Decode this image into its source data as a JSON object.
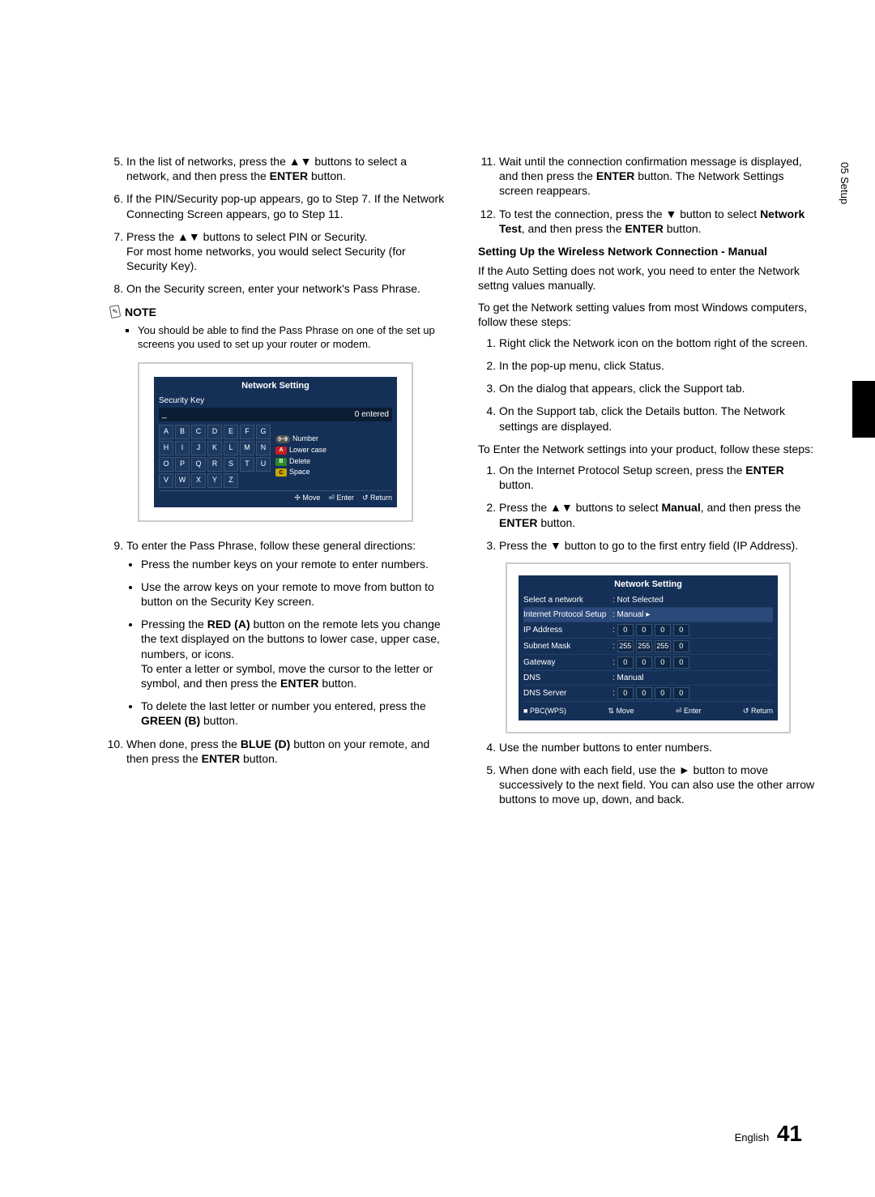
{
  "sideTab": "05 Setup",
  "left": {
    "step5": {
      "pre": "In the list of networks, press the ",
      "arrows": "▲▼",
      "mid": " buttons to select a network, and then press the ",
      "enter": "ENTER",
      "post": " button."
    },
    "step6": "If the PIN/Security pop-up appears, go to Step 7. If the Network Connecting Screen appears, go to Step 11.",
    "step7": {
      "pre": "Press the ",
      "arrows": "▲▼",
      "post1": " buttons to select PIN or Security.",
      "extra": "For most home networks, you would select Security (for Security Key)."
    },
    "step8": "On the Security screen, enter your network's Pass Phrase.",
    "noteLabel": "NOTE",
    "noteItem": "You should be able to find the Pass Phrase on one of the set up screens you used to set up your router or modem.",
    "fig1": {
      "title": "Network Setting",
      "sub": "Security Key",
      "entered": "0 entered",
      "rows": [
        [
          "A",
          "B",
          "C",
          "D",
          "E",
          "F",
          "G"
        ],
        [
          "H",
          "I",
          "J",
          "K",
          "L",
          "M",
          "N"
        ],
        [
          "O",
          "P",
          "Q",
          "R",
          "S",
          "T",
          "U"
        ],
        [
          "V",
          "W",
          "X",
          "Y",
          "Z"
        ]
      ],
      "legend": {
        "number": "Number",
        "lower": "Lower case",
        "delete": "Delete",
        "space": "Space"
      },
      "footer": {
        "move": "Move",
        "enter": "Enter",
        "return": "Return"
      }
    },
    "step9Intro": "To enter the Pass Phrase, follow these general directions:",
    "bullets": {
      "b1": "Press the number keys on your remote to enter numbers.",
      "b2": "Use the arrow keys on your remote to move from button to button on the Security Key screen.",
      "b3a": "Pressing the ",
      "b3red": "RED (A)",
      "b3b": " button on the remote lets you change the text displayed on the buttons to lower case, upper case, numbers, or icons.",
      "b3c": "To enter a letter or symbol, move the cursor to the letter or symbol, and then press the ",
      "b3enter": "ENTER",
      "b3d": " button.",
      "b4a": "To delete the last letter or number you entered, press the ",
      "b4green": "GREEN (B)",
      "b4b": " button."
    },
    "step10": {
      "pre": "When done, press the ",
      "blue": "BLUE (D)",
      "mid": " button on your remote, and then press the ",
      "enter": "ENTER",
      "post": " button."
    }
  },
  "right": {
    "step11": {
      "pre": "Wait until the connection confirmation message is displayed, and then press the ",
      "enter": "ENTER",
      "post": " button. The Network Settings screen reappears."
    },
    "step12": {
      "pre": "To test the connection, press the ",
      "arrow": "▼",
      "mid": " button to select ",
      "nt": "Network Test",
      "mid2": ", and then press the ",
      "enter": "ENTER",
      "post": " button."
    },
    "subheadA": "Setting Up the Wireless Network Connection - Manual",
    "paraA": "If the Auto Setting does not work, you need to enter the Network settng values manually.",
    "paraB": "To get the Network setting values from most Windows computers, follow these steps:",
    "listA": {
      "i1": "Right click the Network icon on the bottom right of the screen.",
      "i2": "In the pop-up menu, click Status.",
      "i3": "On the dialog that appears, click the Support tab.",
      "i4": "On the Support tab, click the Details button. The Network settings are displayed."
    },
    "paraC": "To Enter the Network settings into your product, follow these steps:",
    "listB": {
      "i1a": "On the Internet Protocol Setup screen, press the ",
      "i1enter": "ENTER",
      "i1b": " button.",
      "i2a": "Press the ",
      "i2arrows": "▲▼",
      "i2b": " buttons to select ",
      "i2manual": "Manual",
      "i2c": ", and then press the ",
      "i2enter": "ENTER",
      "i2d": " button.",
      "i3a": "Press the ",
      "i3arrow": "▼",
      "i3b": " button to go to the first entry field (IP Address)."
    },
    "fig2": {
      "title": "Network Setting",
      "rows": {
        "selectLabel": "Select a network",
        "selectVal": ": Not Selected",
        "ipsLabel": "Internet Protocol Setup",
        "ipsVal": ": Manual",
        "ipLabel": "IP Address",
        "ipVals": [
          "0",
          "0",
          "0",
          "0"
        ],
        "snLabel": "Subnet Mask",
        "snVals": [
          "255",
          "255",
          "255",
          "0"
        ],
        "gwLabel": "Gateway",
        "gwVals": [
          "0",
          "0",
          "0",
          "0"
        ],
        "dnsLabel": "DNS",
        "dnsVal": ": Manual",
        "dnssLabel": "DNS Server",
        "dnssVals": [
          "0",
          "0",
          "0",
          "0"
        ]
      },
      "footer": {
        "pbc": "PBC(WPS)",
        "move": "Move",
        "enter": "Enter",
        "return": "Return"
      }
    },
    "listC": {
      "i4": "Use the number buttons to enter numbers.",
      "i5a": "When done with each field, use the ",
      "i5arrow": "►",
      "i5b": " button to move successively to the next field. You can also use the other arrow buttons to move up, down, and back."
    }
  },
  "pageLabel": "English",
  "pageNum": "41"
}
